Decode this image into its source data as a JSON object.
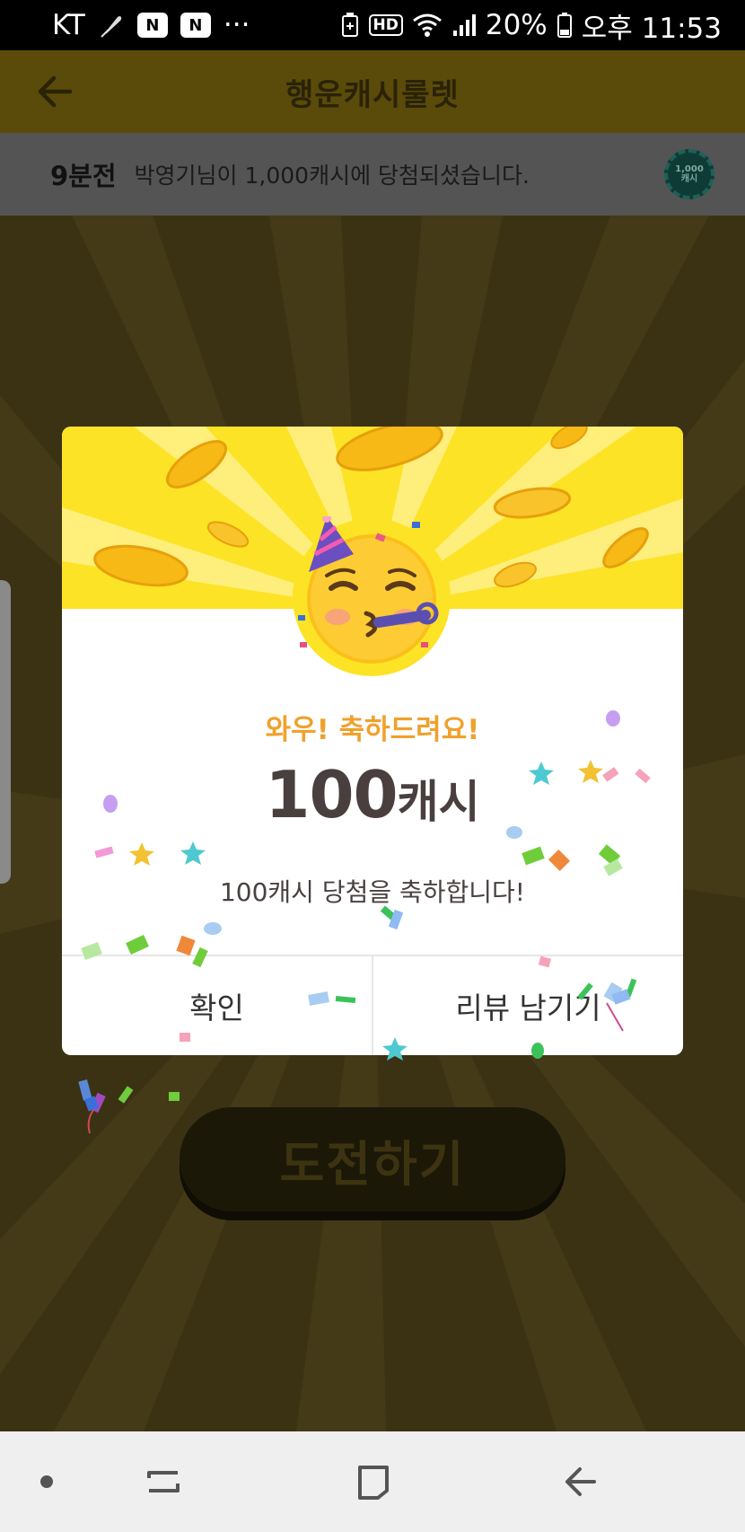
{
  "status_bar": {
    "carrier": "KT",
    "more": "···",
    "hd": "HD",
    "battery": "20%",
    "time": "오후 11:53"
  },
  "header": {
    "title": "행운캐시룰렛",
    "back_icon": "arrow-left-icon"
  },
  "ticker": {
    "time_ago": "9분전",
    "message": "박영기님이 1,000캐시에 당첨되셨습니다.",
    "chip_line1": "1,000",
    "chip_line2": "캐시"
  },
  "challenge_button": {
    "label": "도전하기"
  },
  "modal": {
    "headline": "와우! 축하드려요!",
    "amount_number": "100",
    "amount_unit": "캐시",
    "message": "100캐시 당첨을 축하합니다!",
    "confirm_label": "확인",
    "review_label": "리뷰 남기기"
  },
  "nav": {
    "items": [
      "dot-icon",
      "recent-apps-icon",
      "home-icon",
      "back-icon"
    ]
  },
  "colors": {
    "accent_yellow": "#fde326",
    "headline_orange": "#f0a12c",
    "dim_overlay": "#3b3214"
  }
}
